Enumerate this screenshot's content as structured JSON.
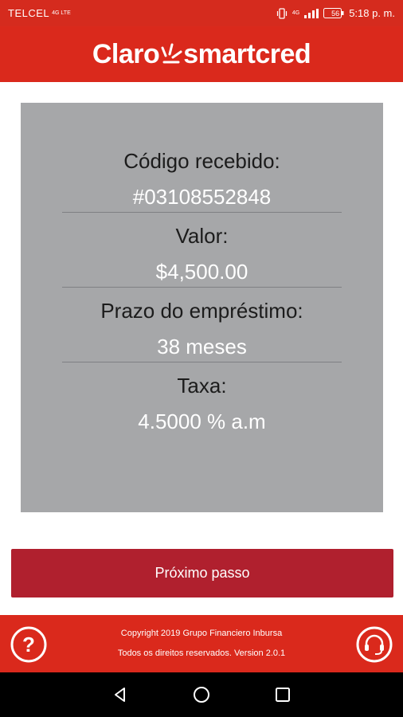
{
  "status_bar": {
    "carrier": "TELCEL",
    "network_tiny": "4G LTE",
    "signal_tiny": "4G",
    "battery": "56",
    "time": "5:18 p. m."
  },
  "header": {
    "logo_left": "Claro",
    "logo_right": "smartcred"
  },
  "card": {
    "code_label": "Código recebido:",
    "code_value": "#03108552848",
    "amount_label": "Valor:",
    "amount_value": "$4,500.00",
    "term_label": "Prazo do empréstimo:",
    "term_value": "38 meses",
    "rate_label": "Taxa:",
    "rate_value": "4.5000 % a.m"
  },
  "next_button": {
    "label": "Próximo passo"
  },
  "footer": {
    "copyright": "Copyright 2019 Grupo Financiero Inbursa",
    "rights_version": "Todos os direitos reservados.  Version  2.0.1"
  },
  "icons": {
    "help": "help-circle-icon",
    "support": "headset-icon",
    "back": "nav-back-icon",
    "home": "nav-home-icon",
    "recents": "nav-recents-icon"
  },
  "colors": {
    "brand_red": "#da291c",
    "button_red": "#b0202e",
    "card_gray": "#a6a7a9"
  }
}
